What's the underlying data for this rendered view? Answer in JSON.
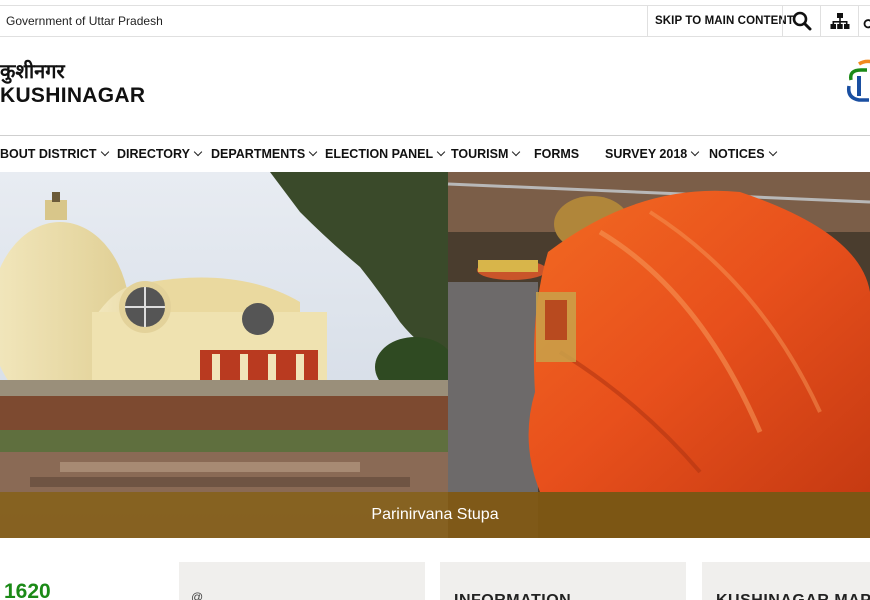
{
  "topbar": {
    "government_label": "Government of Uttar Pradesh",
    "skip_link": "SKIP TO MAIN CONTENT",
    "search_icon": "search-icon",
    "sitemap_icon": "sitemap-icon"
  },
  "header": {
    "site_name_hindi": "कुशीनगर",
    "site_name": "KUSHINAGAR"
  },
  "nav": {
    "items": [
      {
        "label": "BOUT DISTRICT",
        "has_dropdown": true
      },
      {
        "label": "DIRECTORY",
        "has_dropdown": true
      },
      {
        "label": "DEPARTMENTS",
        "has_dropdown": true
      },
      {
        "label": "ELECTION PANEL",
        "has_dropdown": true
      },
      {
        "label": "TOURISM",
        "has_dropdown": true
      },
      {
        "label": "FORMS",
        "has_dropdown": false
      },
      {
        "label": "SURVEY 2018",
        "has_dropdown": true
      },
      {
        "label": "NOTICES",
        "has_dropdown": true
      }
    ]
  },
  "hero": {
    "caption": "Parinirvana Stupa"
  },
  "stats": {
    "number": "1620"
  },
  "cards": {
    "card1_icon": "@",
    "card2_title": "INFORMATION",
    "card3_title": "KUSHINAGAR MAP"
  },
  "colors": {
    "caption_bg": "#805812",
    "stat_green": "#1b8a17",
    "card_bg": "#f0efed"
  }
}
